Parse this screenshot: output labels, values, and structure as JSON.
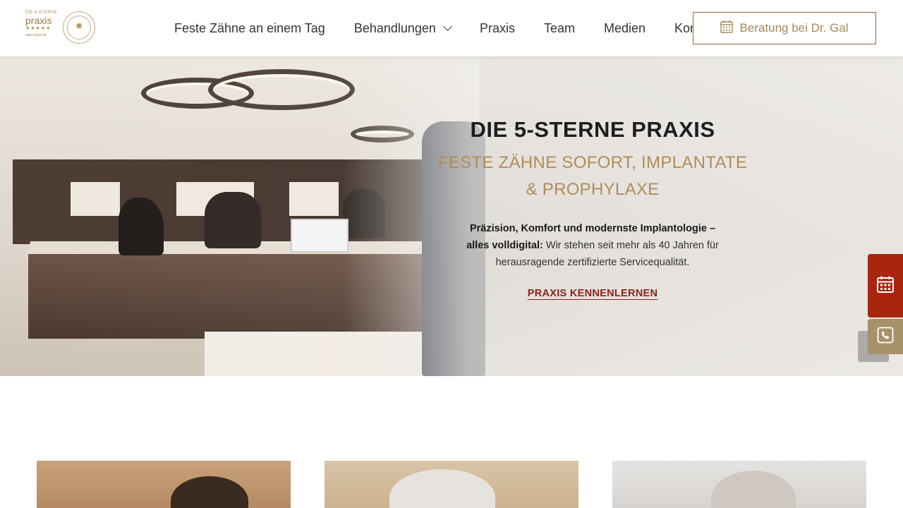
{
  "header": {
    "logo": {
      "small_text": "DIE 5-STERNE",
      "name": "praxis",
      "stars": "★★★★★",
      "url": "www.drgal.de"
    },
    "nav": [
      {
        "label": "Feste Zähne an einem Tag"
      },
      {
        "label": "Behandlungen"
      },
      {
        "label": "Praxis"
      },
      {
        "label": "Team"
      },
      {
        "label": "Medien"
      },
      {
        "label": "Kontakt"
      }
    ],
    "cta_label": "Beratung bei Dr. Gal"
  },
  "hero": {
    "title": "DIE 5-STERNE PRAXIS",
    "subtitle_line1": "FESTE ZÄHNE SOFORT, IMPLANTATE",
    "subtitle_line2": "& PROPHYLAXE",
    "text_bold": "Präzision, Komfort und modernste Implantologie – alles volldigital:",
    "text_regular": " Wir stehen seit mehr als 40 Jahren für herausragende zertifizierte Servicequalität.",
    "link_label": "PRAXIS KENNENLERNEN"
  },
  "side_buttons": {
    "calendar_icon": "calendar-icon",
    "phone_icon": "phone-icon"
  },
  "colors": {
    "gold": "#b08d57",
    "accent_red": "#a8260f",
    "link_red": "#8c2318",
    "phone_button": "#a6916a"
  }
}
